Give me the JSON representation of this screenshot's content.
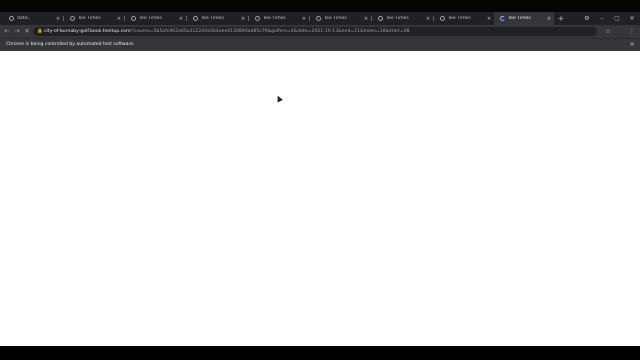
{
  "tabs": [
    {
      "label": "data:,",
      "icon": "globe-icon",
      "active": false
    },
    {
      "label": "Tee Times",
      "icon": "site-icon",
      "active": false
    },
    {
      "label": "Tee Times",
      "icon": "site-icon",
      "active": false
    },
    {
      "label": "Tee Times",
      "icon": "site-icon",
      "active": false
    },
    {
      "label": "Tee Times",
      "icon": "site-icon",
      "active": false
    },
    {
      "label": "Tee Times",
      "icon": "site-icon",
      "active": false
    },
    {
      "label": "Tee Times",
      "icon": "site-icon",
      "active": false
    },
    {
      "label": "Tee Times",
      "icon": "site-icon",
      "active": false
    },
    {
      "label": "Tee Times",
      "icon": "loading-spinner-icon",
      "active": true
    }
  ],
  "tab_close_glyph": "×",
  "new_tab_glyph": "+",
  "window_controls": {
    "profile": "⚙",
    "minimize": "–",
    "maximize": "▢",
    "close": "✕"
  },
  "toolbar": {
    "back": "←",
    "forward": "→",
    "reload": "✕",
    "lock": "🔒",
    "url_host": "city-of-burnaby-golf.book.teeitup.com",
    "url_rest": "/?course=5b5afc962a05a312240a5b4aee4130890ad85c79&golfers=4&date=2021-10-13&end=21&holes=18&start=08",
    "bookmark": "☆",
    "menu": "⋮"
  },
  "infobar": {
    "text": "Chrome is being controlled by automated test software.",
    "close": "✕"
  },
  "colors": {
    "tabstrip": "#202124",
    "toolbar": "#35363a",
    "page": "#ffffff"
  }
}
